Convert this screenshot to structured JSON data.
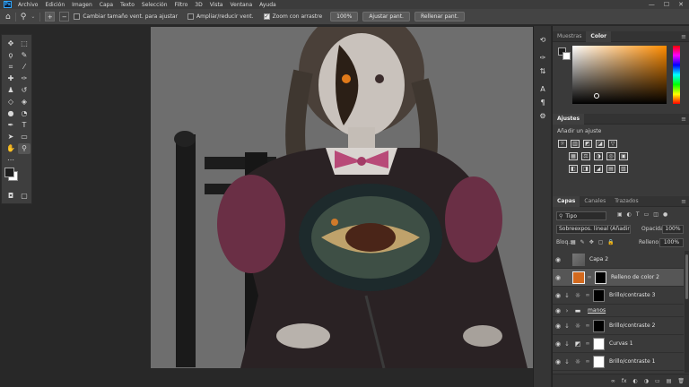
{
  "app": {
    "logo": "Ps"
  },
  "menu": [
    "Archivo",
    "Edición",
    "Imagen",
    "Capa",
    "Texto",
    "Selección",
    "Filtro",
    "3D",
    "Vista",
    "Ventana",
    "Ayuda"
  ],
  "window_controls": {
    "minimize": "—",
    "maximize": "☐",
    "close": "✕"
  },
  "options": {
    "home_icon": "home-icon",
    "zoom_tool_icon": "zoom-icon",
    "zoom_in": "+",
    "zoom_out": "−",
    "resize_windows_label": "Cambiar tamaño vent. para ajustar",
    "resize_windows_checked": false,
    "zoom_all_label": "Ampliar/reducir vent.",
    "zoom_all_checked": false,
    "scrubby_zoom_label": "Zoom con arrastre",
    "scrubby_zoom_checked": true,
    "zoom_value": "100%",
    "fit_screen": "Ajustar pant.",
    "fill_screen": "Rellenar pant."
  },
  "color_panel": {
    "tabs": [
      "Muestras",
      "Color"
    ],
    "selected_tab": "Color",
    "hue_color": "#ff8c00",
    "foreground": "#1e1e1e",
    "background": "#ffffff"
  },
  "adjustments_panel": {
    "title": "Ajustes",
    "subtitle": "Añadir un ajuste",
    "row1": [
      "☼",
      "▥",
      "◩",
      "◪",
      "▽"
    ],
    "row2": [
      "▦",
      "⚖",
      "◑",
      "◎",
      "▣"
    ],
    "row3": [
      "◧",
      "◨",
      "◢",
      "▤",
      "▧"
    ]
  },
  "layers_panel": {
    "tabs": [
      "Capas",
      "Canales",
      "Trazados"
    ],
    "selected_tab": "Capas",
    "filter_kind": "Tipo",
    "blend_mode": "Sobreexpos. lineal (Añadir)",
    "opacity_label": "Opacidad:",
    "opacity_value": "100%",
    "lock_label": "Bloq.:",
    "fill_label": "Relleno:",
    "fill_value": "100%",
    "layers": [
      {
        "name": "Capa 2",
        "type": "pixel",
        "selected": false
      },
      {
        "name": "Relleno de color 2",
        "type": "fill",
        "selected": true
      },
      {
        "name": "Brillo/contraste 3",
        "type": "adjust",
        "selected": false
      },
      {
        "name": "manos",
        "type": "group",
        "selected": false
      },
      {
        "name": "Brillo/contraste 2",
        "type": "adjust",
        "selected": false
      },
      {
        "name": "Curvas 1",
        "type": "curves",
        "selected": false
      },
      {
        "name": "Brillo/contraste 1",
        "type": "adjust",
        "selected": false
      }
    ],
    "footer_icons": [
      "∞",
      "fx",
      "◐",
      "◑",
      "▭",
      "▤",
      "🗑"
    ]
  }
}
